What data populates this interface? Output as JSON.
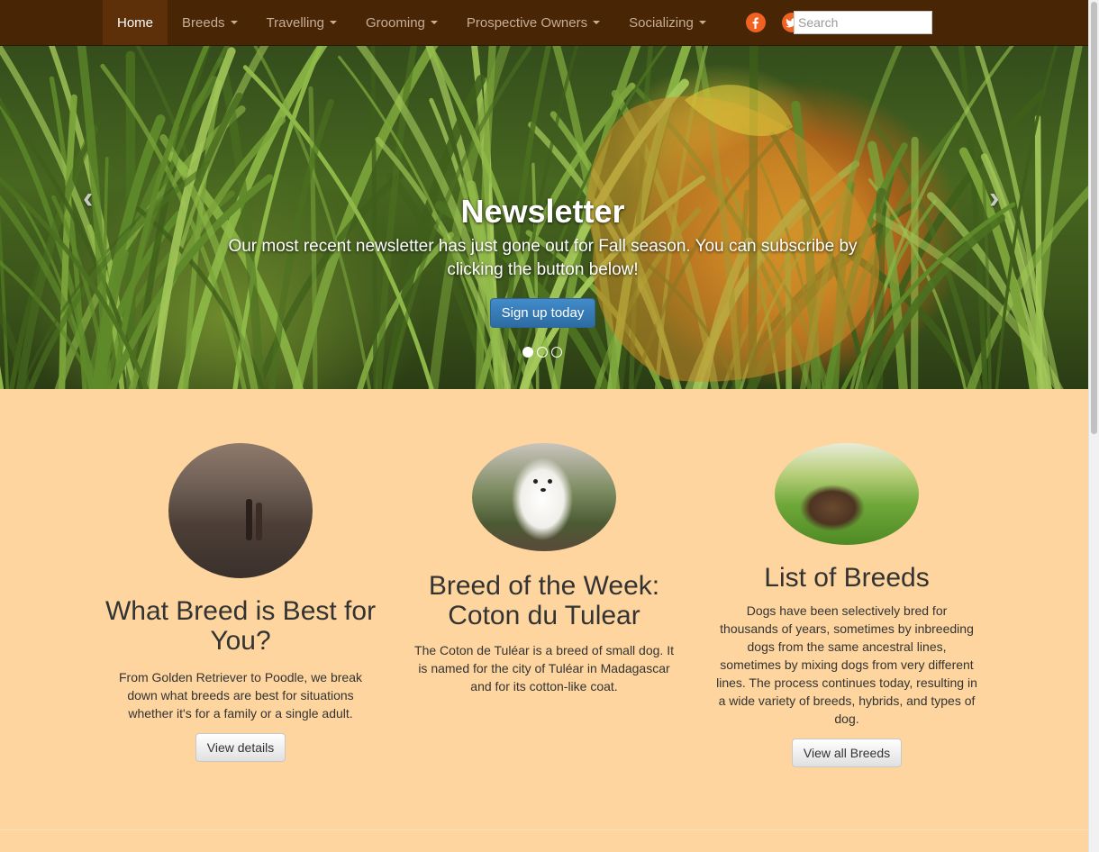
{
  "nav": {
    "items": [
      {
        "label": "Home",
        "active": true,
        "dropdown": false
      },
      {
        "label": "Breeds",
        "active": false,
        "dropdown": true
      },
      {
        "label": "Travelling",
        "active": false,
        "dropdown": true
      },
      {
        "label": "Grooming",
        "active": false,
        "dropdown": true
      },
      {
        "label": "Prospective Owners",
        "active": false,
        "dropdown": true
      },
      {
        "label": "Socializing",
        "active": false,
        "dropdown": true
      }
    ],
    "social": {
      "facebook_icon": "facebook-icon",
      "twitter_icon": "twitter-icon"
    },
    "search_placeholder": "Search"
  },
  "hero": {
    "title": "Newsletter",
    "text": "Our most recent newsletter has just gone out for Fall season. You can subscribe by clicking the button below!",
    "button": "Sign up today",
    "prev_glyph": "‹",
    "next_glyph": "›",
    "slides": 3,
    "active_slide": 1
  },
  "columns": [
    {
      "title": "What Breed is Best for You?",
      "text": "From Golden Retriever to Poodle, we break down what breeds are best for situations whether it's for a family or a single adult.",
      "button": "View details"
    },
    {
      "title": "Breed of the Week: Coton du Tulear",
      "text": "The Coton de Tuléar is a breed of small dog. It is named for the city of Tuléar in Madagascar and for its cotton-like coat.",
      "button": ""
    },
    {
      "title": "List of Breeds",
      "text": "Dogs have been selectively bred for thousands of years, sometimes by inbreeding dogs from the same ancestral lines, sometimes by mixing dogs from very different lines. The process continues today, resulting in a wide variety of breeds, hybrids, and types of dog.",
      "button": "View all Breeds"
    }
  ],
  "colors": {
    "navbar": "#472505",
    "accent": "#ef6221",
    "page_bg": "#fed59e",
    "primary_button": "#428bca"
  }
}
